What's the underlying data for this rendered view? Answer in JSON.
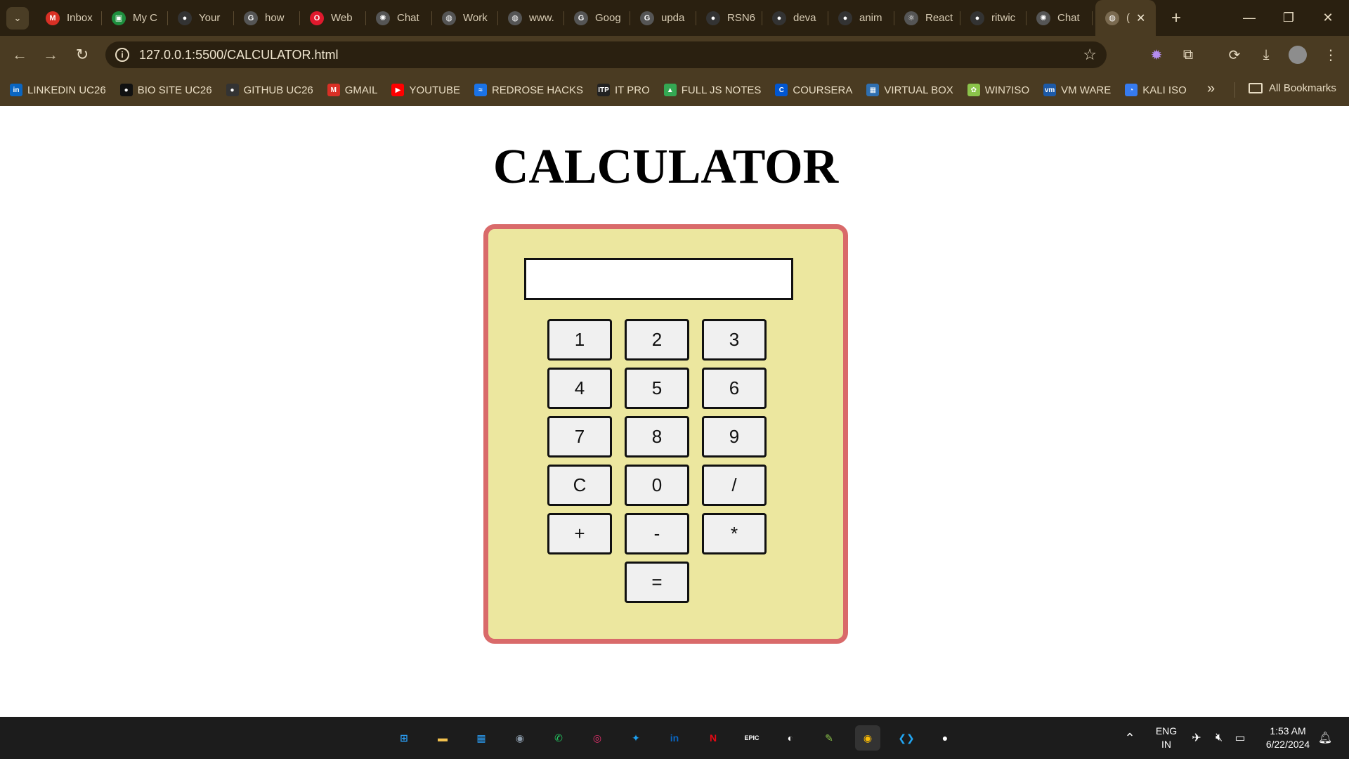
{
  "browser": {
    "tabs": [
      {
        "label": "Inbox",
        "icon": "gmail-icon",
        "color": "#d93025",
        "glyph": "M"
      },
      {
        "label": "My C",
        "icon": "classroom-icon",
        "color": "#1e8e3e",
        "glyph": "▣"
      },
      {
        "label": "Your",
        "icon": "github-icon",
        "color": "#333333",
        "glyph": "●"
      },
      {
        "label": "how",
        "icon": "google-icon",
        "color": "#555555",
        "glyph": "G"
      },
      {
        "label": "Web",
        "icon": "opera-icon",
        "color": "#e0192d",
        "glyph": "O"
      },
      {
        "label": "Chat",
        "icon": "chatgpt-icon",
        "color": "#555555",
        "glyph": "✺"
      },
      {
        "label": "Work",
        "icon": "globe-icon",
        "color": "#555555",
        "glyph": "◍"
      },
      {
        "label": "www.",
        "icon": "globe-icon",
        "color": "#555555",
        "glyph": "◍"
      },
      {
        "label": "Goog",
        "icon": "google-icon",
        "color": "#555555",
        "glyph": "G"
      },
      {
        "label": "upda",
        "icon": "google-icon",
        "color": "#555555",
        "glyph": "G"
      },
      {
        "label": "RSN6",
        "icon": "github-icon",
        "color": "#333333",
        "glyph": "●"
      },
      {
        "label": "deva",
        "icon": "github-icon",
        "color": "#333333",
        "glyph": "●"
      },
      {
        "label": "anim",
        "icon": "github-icon",
        "color": "#333333",
        "glyph": "●"
      },
      {
        "label": "React",
        "icon": "react-icon",
        "color": "#555555",
        "glyph": "⚛"
      },
      {
        "label": "ritwic",
        "icon": "github-icon",
        "color": "#333333",
        "glyph": "●"
      },
      {
        "label": "Chat",
        "icon": "chatgpt-icon",
        "color": "#555555",
        "glyph": "✺"
      }
    ],
    "active_tab": {
      "label": "(",
      "icon": "globe-icon"
    },
    "new_tab": "+",
    "url": "127.0.0.1:5500/CALCULATOR.html",
    "bookmarks": [
      {
        "label": "LINKEDIN UC26",
        "icon": "linkedin-icon",
        "color": "#0a66c2",
        "glyph": "in"
      },
      {
        "label": "BIO SITE UC26",
        "icon": "biosite-icon",
        "color": "#111111",
        "glyph": "●"
      },
      {
        "label": "GITHUB UC26",
        "icon": "github-icon",
        "color": "#333333",
        "glyph": "●"
      },
      {
        "label": "GMAIL",
        "icon": "gmail-icon",
        "color": "#d93025",
        "glyph": "M"
      },
      {
        "label": "YOUTUBE",
        "icon": "youtube-icon",
        "color": "#ff0000",
        "glyph": "▶"
      },
      {
        "label": "REDROSE HACKS",
        "icon": "redrose-icon",
        "color": "#1a73e8",
        "glyph": "≈"
      },
      {
        "label": "IT PRO",
        "icon": "itpro-icon",
        "color": "#222222",
        "glyph": "ITP"
      },
      {
        "label": "FULL JS NOTES",
        "icon": "drive-icon",
        "color": "#34a853",
        "glyph": "▲"
      },
      {
        "label": "COURSERA",
        "icon": "coursera-icon",
        "color": "#0056d2",
        "glyph": "C"
      },
      {
        "label": "VIRTUAL BOX",
        "icon": "virtualbox-icon",
        "color": "#2f6fb0",
        "glyph": "▦"
      },
      {
        "label": "WIN7ISO",
        "icon": "win7-icon",
        "color": "#8bc34a",
        "glyph": "✿"
      },
      {
        "label": "VM WARE",
        "icon": "vmware-icon",
        "color": "#1d5aa8",
        "glyph": "vm"
      },
      {
        "label": "KALI ISO",
        "icon": "kali-icon",
        "color": "#367bf0",
        "glyph": "◔"
      }
    ],
    "all_bookmarks": "All Bookmarks"
  },
  "page": {
    "title": "CALCULATOR",
    "display_value": "",
    "keys": [
      {
        "label": "1",
        "name": "key-1"
      },
      {
        "label": "2",
        "name": "key-2"
      },
      {
        "label": "3",
        "name": "key-3"
      },
      {
        "label": "4",
        "name": "key-4"
      },
      {
        "label": "5",
        "name": "key-5"
      },
      {
        "label": "6",
        "name": "key-6"
      },
      {
        "label": "7",
        "name": "key-7"
      },
      {
        "label": "8",
        "name": "key-8"
      },
      {
        "label": "9",
        "name": "key-9"
      },
      {
        "label": "C",
        "name": "key-clear"
      },
      {
        "label": "0",
        "name": "key-0"
      },
      {
        "label": "/",
        "name": "key-divide"
      },
      {
        "label": "+",
        "name": "key-add"
      },
      {
        "label": "-",
        "name": "key-subtract"
      },
      {
        "label": "*",
        "name": "key-multiply"
      },
      {
        "label": "=",
        "name": "key-equals"
      }
    ],
    "colors": {
      "panel": "#ece79f",
      "panel_border": "#d96a6a"
    }
  },
  "taskbar": {
    "apps": [
      {
        "name": "windows-start-icon",
        "glyph": "⊞",
        "color": "#2a9df4"
      },
      {
        "name": "file-explorer-icon",
        "glyph": "▬",
        "color": "#f2c14e"
      },
      {
        "name": "microsoft-store-icon",
        "glyph": "▦",
        "color": "#2a9df4"
      },
      {
        "name": "camera-icon",
        "glyph": "◉",
        "color": "#8a99a8"
      },
      {
        "name": "whatsapp-icon",
        "glyph": "✆",
        "color": "#25d366"
      },
      {
        "name": "instagram-icon",
        "glyph": "◎",
        "color": "#e1306c"
      },
      {
        "name": "twitter-icon",
        "glyph": "✦",
        "color": "#1da1f2"
      },
      {
        "name": "linkedin-icon",
        "glyph": "in",
        "color": "#0a66c2"
      },
      {
        "name": "netflix-icon",
        "glyph": "N",
        "color": "#e50914"
      },
      {
        "name": "epic-games-icon",
        "glyph": "EPIC",
        "color": "#ffffff"
      },
      {
        "name": "obs-icon",
        "glyph": "◐",
        "color": "#ffffff"
      },
      {
        "name": "notepad-icon",
        "glyph": "✎",
        "color": "#8bc34a"
      },
      {
        "name": "chrome-icon",
        "glyph": "◉",
        "color": "#fbbc05"
      },
      {
        "name": "vscode-icon",
        "glyph": "❮❯",
        "color": "#22a6f2"
      },
      {
        "name": "github-desktop-icon",
        "glyph": "●",
        "color": "#ffffff"
      }
    ],
    "language_line1": "ENG",
    "language_line2": "IN",
    "time": "1:53 AM",
    "date": "6/22/2024"
  }
}
